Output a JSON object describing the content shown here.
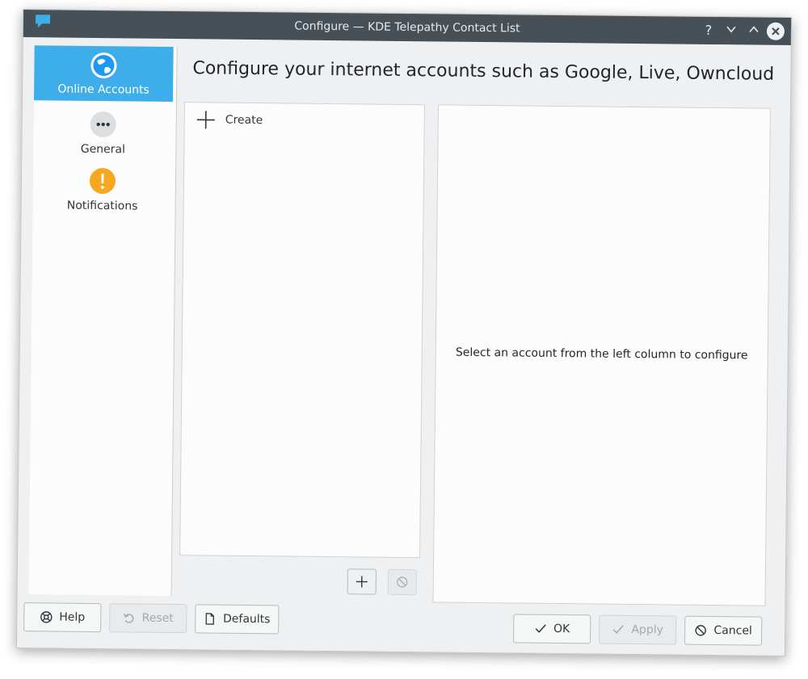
{
  "window": {
    "title": "Configure — KDE Telepathy Contact List",
    "controls": [
      "?",
      "v",
      "^",
      "close"
    ]
  },
  "sidebar": {
    "items": [
      {
        "label": "Online Accounts",
        "icon": "globe-icon",
        "selected": true
      },
      {
        "label": "General",
        "icon": "ellipsis-icon",
        "selected": false
      },
      {
        "label": "Notifications",
        "icon": "warning-icon",
        "selected": false
      }
    ]
  },
  "main": {
    "heading": "Configure your internet accounts such as Google, Live, Owncloud",
    "list": {
      "create_label": "Create"
    },
    "detail": {
      "placeholder": "Select an account from the left column to configure"
    }
  },
  "buttons": {
    "help": "Help",
    "reset": "Reset",
    "defaults": "Defaults",
    "ok": "OK",
    "apply": "Apply",
    "cancel": "Cancel"
  },
  "colors": {
    "accent": "#3daee9",
    "titlebar": "#475057",
    "warning": "#f6a823"
  }
}
